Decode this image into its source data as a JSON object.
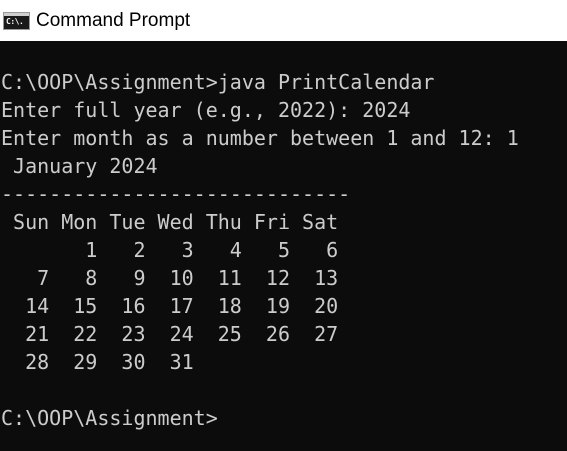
{
  "window": {
    "title": "Command Prompt",
    "icon_text": "C:\\."
  },
  "console": {
    "lines": [
      "C:\\OOP\\Assignment>java PrintCalendar",
      "Enter full year (e.g., 2022): 2024",
      "Enter month as a number between 1 and 12: 1",
      " January 2024",
      "-----------------------------",
      " Sun Mon Tue Wed Thu Fri Sat",
      "       1   2   3   4   5   6",
      "   7   8   9  10  11  12  13",
      "  14  15  16  17  18  19  20",
      "  21  22  23  24  25  26  27",
      "  28  29  30  31",
      "",
      "C:\\OOP\\Assignment>"
    ]
  },
  "colors": {
    "console_background": "#0c0c0c",
    "console_text": "#cccccc",
    "titlebar_background": "#ffffff",
    "titlebar_text": "#000000"
  },
  "icons": {
    "app_icon": "command-prompt-icon"
  }
}
